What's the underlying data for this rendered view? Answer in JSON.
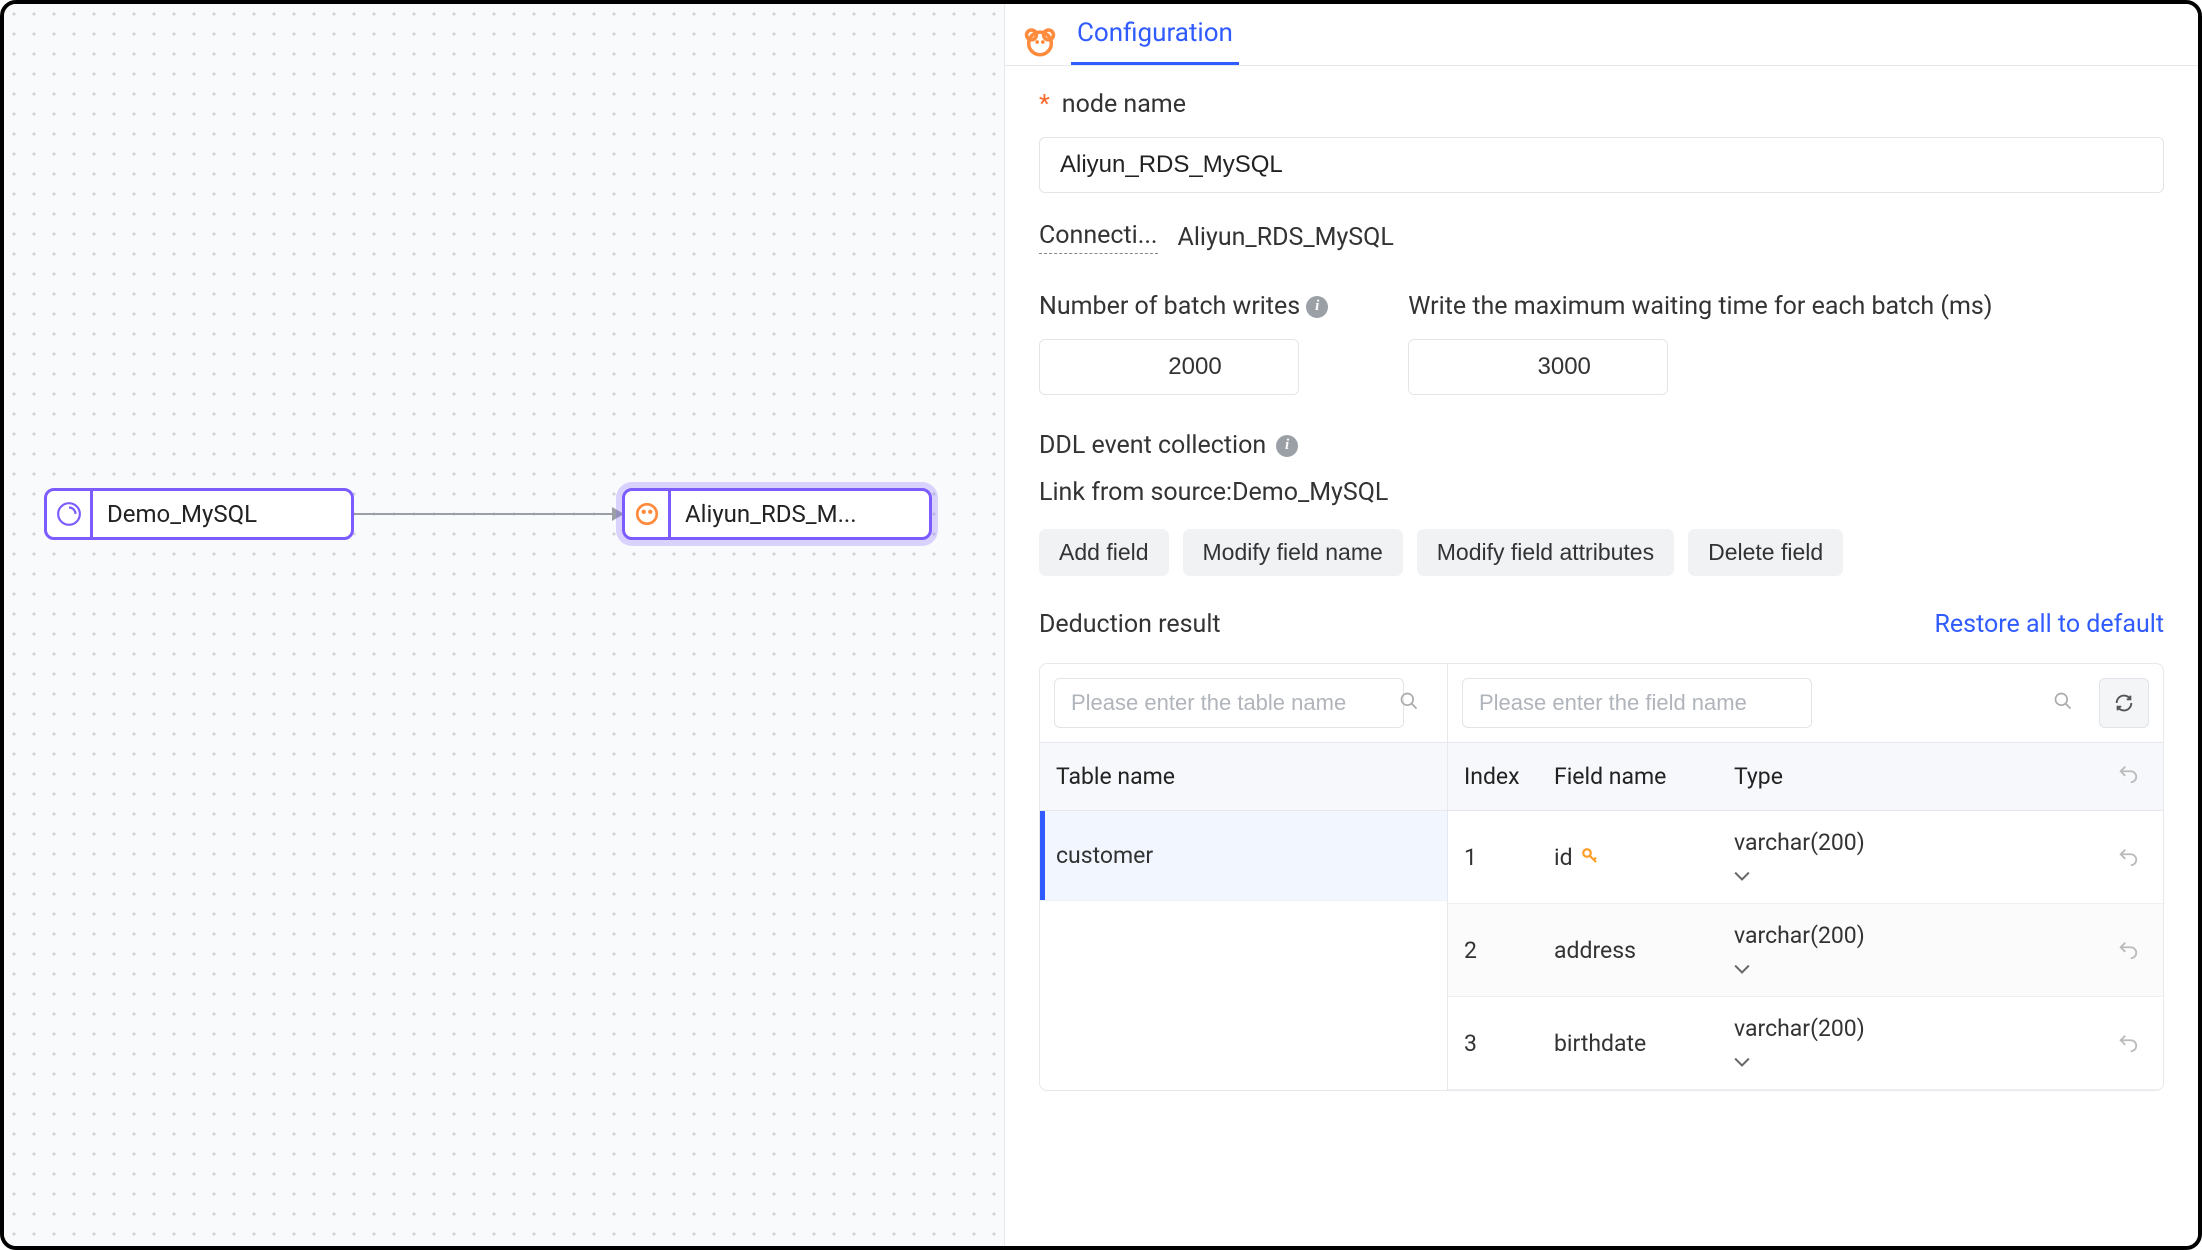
{
  "canvas": {
    "source_node": "Demo_MySQL",
    "target_node": "Aliyun_RDS_M..."
  },
  "panel": {
    "tab": "Configuration",
    "node_name_label": "node name",
    "node_name_value": "Aliyun_RDS_MySQL",
    "connection_label": "Connecti...",
    "connection_value": "Aliyun_RDS_MySQL",
    "batch_writes_label": "Number of batch writes",
    "batch_writes_value": "2000",
    "max_wait_label": "Write the maximum waiting time for each batch (ms)",
    "max_wait_value": "3000",
    "ddl_label": "DDL event collection",
    "link_from_label": "Link from source:Demo_MySQL",
    "buttons": {
      "add_field": "Add field",
      "modify_name": "Modify field name",
      "modify_attrs": "Modify field attributes",
      "delete_field": "Delete field"
    },
    "deduction_title": "Deduction result",
    "restore_link": "Restore all to default",
    "table_search_placeholder": "Please enter the table name",
    "field_search_placeholder": "Please enter the field name",
    "table_header": "Table name",
    "tables": [
      {
        "name": "customer"
      }
    ],
    "field_headers": {
      "index": "Index",
      "field_name": "Field name",
      "type": "Type"
    },
    "fields": [
      {
        "index": "1",
        "name": "id",
        "type": "varchar(200)",
        "is_key": true
      },
      {
        "index": "2",
        "name": "address",
        "type": "varchar(200)",
        "is_key": false
      },
      {
        "index": "3",
        "name": "birthdate",
        "type": "varchar(200)",
        "is_key": false
      }
    ]
  }
}
